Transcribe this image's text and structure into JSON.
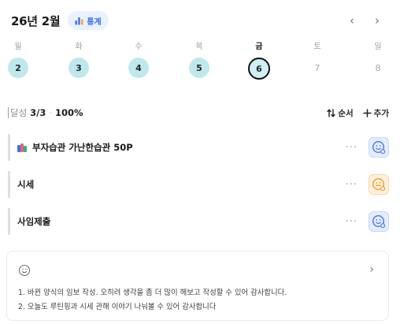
{
  "header": {
    "month_title": "26년 2월",
    "stats_label": "통계",
    "prev_glyph": "‹",
    "next_glyph": "›"
  },
  "week": {
    "days": [
      {
        "label": "월",
        "date": "2",
        "state": "done"
      },
      {
        "label": "화",
        "date": "3",
        "state": "done"
      },
      {
        "label": "수",
        "date": "4",
        "state": "done"
      },
      {
        "label": "목",
        "date": "5",
        "state": "done"
      },
      {
        "label": "금",
        "date": "6",
        "state": "today"
      },
      {
        "label": "토",
        "date": "7",
        "state": "future"
      },
      {
        "label": "일",
        "date": "8",
        "state": "future"
      }
    ]
  },
  "summary": {
    "label": "달성",
    "count": "3/3",
    "percent": "100%",
    "sort_label": "순서",
    "add_label": "추가"
  },
  "habits": [
    {
      "name": "부자습관 가난한습관 50P",
      "has_books_icon": true,
      "more": "···",
      "status_color": "blue"
    },
    {
      "name": "시세",
      "has_books_icon": false,
      "more": "···",
      "status_color": "orange"
    },
    {
      "name": "사임제출",
      "has_books_icon": false,
      "more": "···",
      "status_color": "blue"
    }
  ],
  "memo": {
    "lines": [
      "1. 바뀐 양식의 임보 작성. 오히려 생각을 좀 더 많이 해보고 작성할 수 있어 감사합니다.",
      "2. 오늘도 루틴핑과 시세 관해 이야기 나눠볼 수 있어 감사합니다"
    ],
    "chevron": "›"
  },
  "colors": {
    "accent_blue": "#3b6ef0",
    "done_teal": "#bfe8ec",
    "status_orange": "#f0a33a"
  },
  "icons": {
    "stats": "bar-chart-icon",
    "sort": "sort-arrows-icon",
    "add": "plus-icon",
    "habit_status": "smile-face-icon",
    "memo": "smile-face-icon"
  }
}
